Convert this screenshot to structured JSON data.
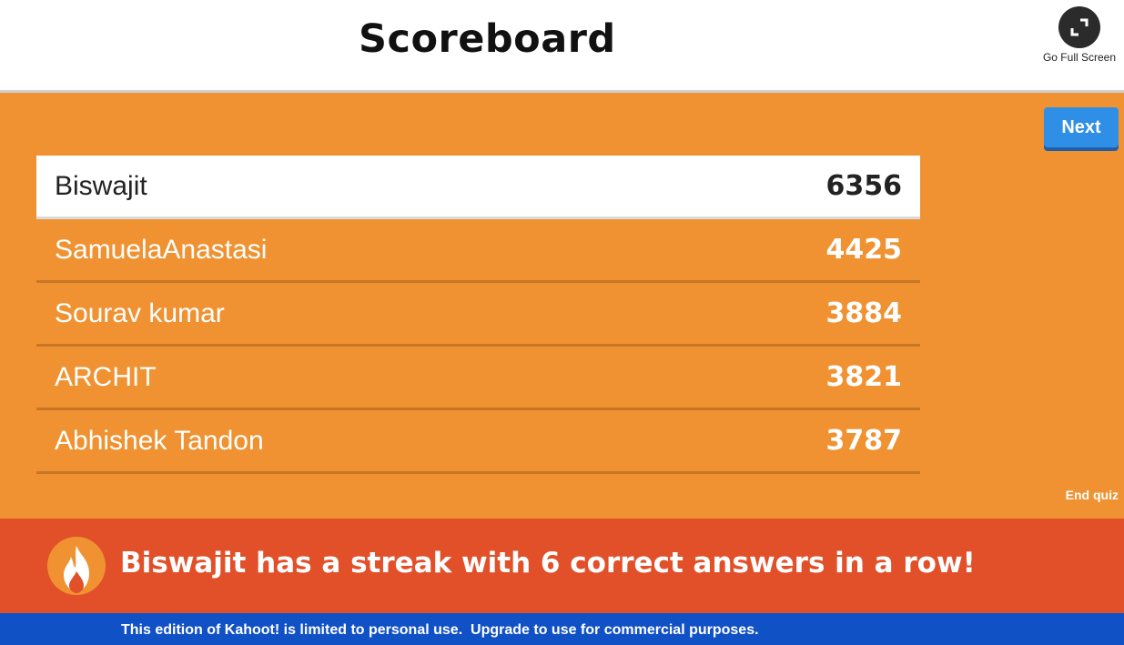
{
  "header": {
    "title": "Scoreboard",
    "fullscreen_label": "Go Full Screen",
    "fullscreen_icon": "expand-icon"
  },
  "controls": {
    "next_label": "Next",
    "end_quiz_label": "End quiz"
  },
  "scoreboard": {
    "rows": [
      {
        "name": "Biswajit",
        "score": "6356"
      },
      {
        "name": "SamuelaAnastasi",
        "score": "4425"
      },
      {
        "name": "Sourav kumar",
        "score": "3884"
      },
      {
        "name": "ARCHIT",
        "score": "3821"
      },
      {
        "name": "Abhishek Tandon",
        "score": "3787"
      }
    ]
  },
  "streak": {
    "icon": "flame-icon",
    "text": "Biswajit has a streak with 6 correct answers in a row!"
  },
  "footer": {
    "text": "This edition of Kahoot! is limited to personal use.  Upgrade to use for commercial purposes."
  },
  "colors": {
    "background_orange": "#f09231",
    "streak_red": "#e2502a",
    "footer_blue": "#1151c6",
    "next_blue": "#2f8ee6"
  }
}
